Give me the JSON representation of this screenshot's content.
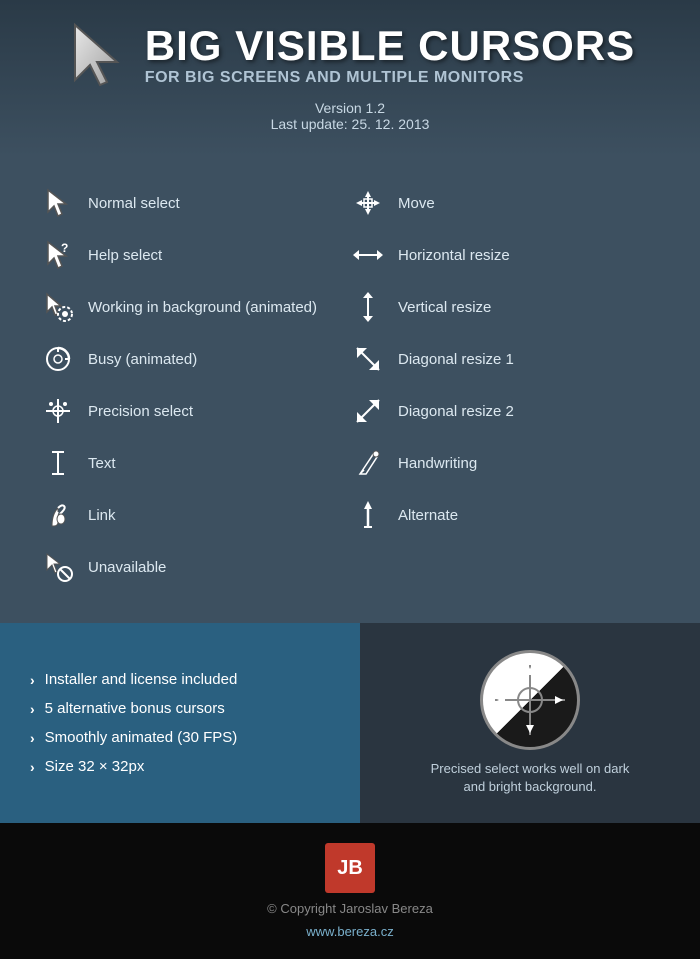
{
  "header": {
    "main_title": "BIG VISIBLE CURSORS",
    "sub_title": "FOR BIG SCREENS AND MULTIPLE MONITORS",
    "version": "Version 1.2",
    "last_update": "Last update: 25. 12. 2013"
  },
  "cursors_left": [
    {
      "id": "normal-select",
      "label": "Normal select",
      "icon": "normal"
    },
    {
      "id": "help-select",
      "label": "Help select",
      "icon": "help"
    },
    {
      "id": "working-background",
      "label": "Working in background (animated)",
      "icon": "working"
    },
    {
      "id": "busy",
      "label": "Busy (animated)",
      "icon": "busy"
    },
    {
      "id": "precision-select",
      "label": "Precision select",
      "icon": "precision"
    },
    {
      "id": "text",
      "label": "Text",
      "icon": "text"
    },
    {
      "id": "link",
      "label": "Link",
      "icon": "link"
    },
    {
      "id": "unavailable",
      "label": "Unavailable",
      "icon": "unavailable"
    }
  ],
  "cursors_right": [
    {
      "id": "move",
      "label": "Move",
      "icon": "move"
    },
    {
      "id": "horizontal-resize",
      "label": "Horizontal resize",
      "icon": "hresize"
    },
    {
      "id": "vertical-resize",
      "label": "Vertical resize",
      "icon": "vresize"
    },
    {
      "id": "diagonal-resize-1",
      "label": "Diagonal resize 1",
      "icon": "dresize1"
    },
    {
      "id": "diagonal-resize-2",
      "label": "Diagonal resize 2",
      "icon": "dresize2"
    },
    {
      "id": "handwriting",
      "label": "Handwriting",
      "icon": "handwriting"
    },
    {
      "id": "alternate",
      "label": "Alternate",
      "icon": "alternate"
    }
  ],
  "features": [
    "Installer and license included",
    "5 alternative bonus cursors",
    "Smoothly animated (30 FPS)",
    "Size 32 × 32px"
  ],
  "preview_caption": "Precised select works well on dark\nand bright background.",
  "footer": {
    "logo": "JB",
    "copyright": "© Copyright Jaroslav Bereza",
    "website": "www.bereza.cz"
  }
}
